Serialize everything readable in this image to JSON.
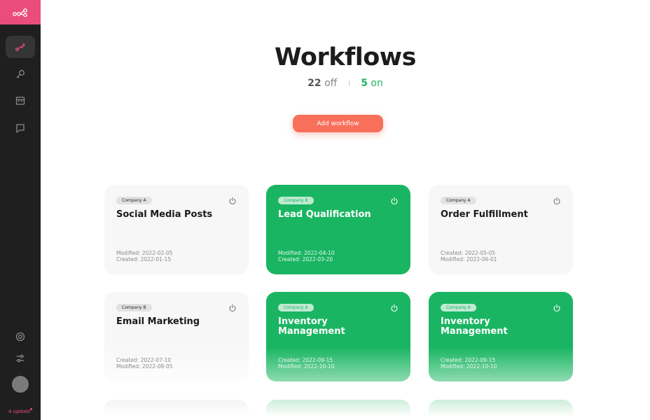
{
  "app": {
    "icons": {
      "logo": "workflow-logo-icon",
      "workflows": "route-icon",
      "keys": "key-icon",
      "store": "store-icon",
      "feedback": "chat-icon",
      "help": "lifebuoy-icon",
      "settings": "sliders-icon"
    },
    "accent": "#ea4d7a",
    "update_label": "4 update"
  },
  "header": {
    "title": "Workflows",
    "off_count": "22",
    "off_label": "off",
    "on_count": "5",
    "on_label": "on"
  },
  "actions": {
    "add_label": "Add workflow",
    "add_color": "#f86f5a"
  },
  "colors": {
    "on": "#1ab562",
    "off": "#f7f7f7"
  },
  "workflows": [
    {
      "company": "Company A",
      "name": "Social Media Posts",
      "status": "off",
      "line1": "Modified: 2022-02-05",
      "line2": "Created: 2022-01-15"
    },
    {
      "company": "Company B",
      "name": "Lead Qualification",
      "status": "on",
      "line1": "Modified: 2022-04-10",
      "line2": "Created: 2022-03-20"
    },
    {
      "company": "Company A",
      "name": "Order Fulfillment",
      "status": "off",
      "line1": "Created: 2022-05-05",
      "line2": "Modified: 2022-06-01"
    },
    {
      "company": "Company B",
      "name": "Email Marketing",
      "status": "off",
      "line1": "Created: 2022-07-10",
      "line2": "Modified: 2022-08-05"
    },
    {
      "company": "Company A",
      "name": "Inventory Management",
      "status": "on",
      "line1": "Created: 2022-09-15",
      "line2": "Modified: 2022-10-10"
    },
    {
      "company": "Company A",
      "name": "Inventory Management",
      "status": "on",
      "line1": "Created: 2022-09-15",
      "line2": "Modified: 2022-10-10"
    }
  ]
}
